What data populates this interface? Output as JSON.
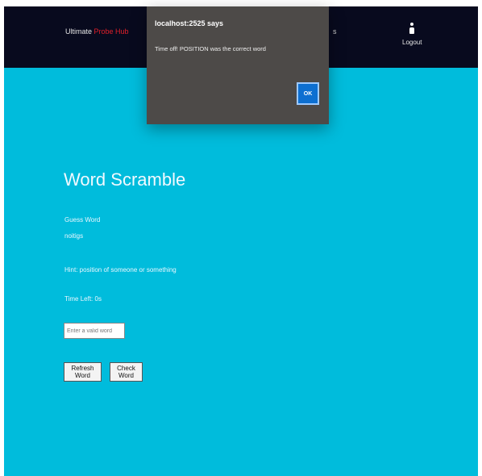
{
  "navbar": {
    "brand_prefix": "Ultimate",
    "brand_accent": "Probe Hub",
    "nav_stub": "s",
    "logout_label": "Logout",
    "colors": {
      "background": "#080a1e",
      "accent": "#e0202a"
    }
  },
  "game": {
    "title": "Word Scramble",
    "guess_label": "Guess Word",
    "scrambled_word": "noitigs",
    "hint": "Hint: position of someone or something",
    "time_left": "Time Left: 0s",
    "input_placeholder": "Enter a valid word",
    "refresh_label": "Refresh Word",
    "check_label": "Check Word",
    "colors": {
      "background": "#00bcdc"
    }
  },
  "dialog": {
    "title": "localhost:2525 says",
    "message": "Time off! POSITION was the correct word",
    "ok_label": "OK",
    "colors": {
      "background": "#4d4a48",
      "button": "#0d6fd1"
    }
  }
}
